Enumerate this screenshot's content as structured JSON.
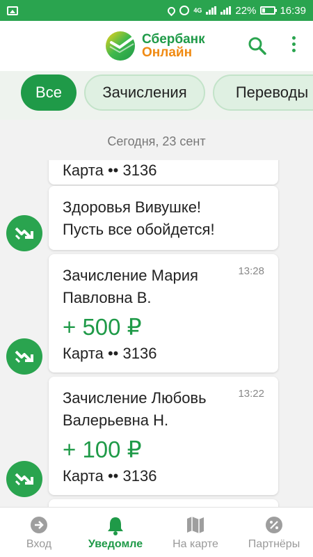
{
  "status_bar": {
    "network": "4G",
    "battery": "22%",
    "time": "16:39"
  },
  "header": {
    "brand_line1": "Сбербанк",
    "brand_line2": "Онлайн",
    "brand_color": "#1f9a48",
    "brand_accent": "#f08a12"
  },
  "filters": {
    "items": [
      {
        "label": "Все",
        "active": true
      },
      {
        "label": "Зачисления",
        "active": false
      },
      {
        "label": "Переводы",
        "active": false
      }
    ]
  },
  "feed": {
    "date_header": "Сегодня, 23 сент",
    "cards": [
      {
        "sub": "Карта •• 3136"
      },
      {
        "line1": "Здоровья Вивушке!",
        "line2": "Пусть все обойдется!"
      },
      {
        "line1": "Зачисление Мария",
        "line2": "Павловна В.",
        "time": "13:28",
        "amount": "+ 500 ₽",
        "sub": "Карта •• 3136"
      },
      {
        "line1": "Зачисление Любовь",
        "line2": "Валерьевна Н.",
        "time": "13:22",
        "amount": "+ 100 ₽",
        "sub": "Карта •• 3136"
      }
    ]
  },
  "bottom_nav": {
    "items": [
      {
        "label": "Вход",
        "icon": "login-icon",
        "active": false
      },
      {
        "label": "Уведомле",
        "icon": "bell-icon",
        "active": true
      },
      {
        "label": "На карте",
        "icon": "map-icon",
        "active": false
      },
      {
        "label": "Партнёры",
        "icon": "percent-icon",
        "active": false
      }
    ]
  }
}
